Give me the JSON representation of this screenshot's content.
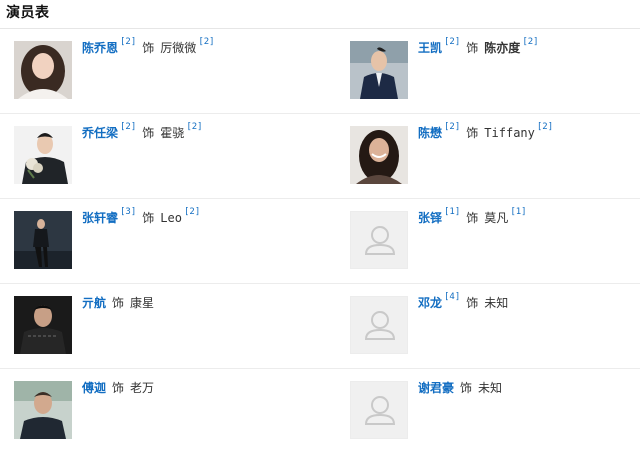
{
  "header": {
    "title": "演员表"
  },
  "rows": [
    {
      "left": {
        "actor": "陈乔恩",
        "actor_ref": "[2]",
        "as": "饰",
        "role": "厉微微",
        "role_ref": "[2]",
        "photo": "photo"
      },
      "right": {
        "actor": "王凯",
        "actor_ref": "[2]",
        "as": "饰",
        "role": "陈亦度",
        "role_ref": "[2]",
        "photo": "photo"
      }
    },
    {
      "left": {
        "actor": "乔任梁",
        "actor_ref": "[2]",
        "as": "饰",
        "role": "霍骁",
        "role_ref": "[2]",
        "photo": "photo"
      },
      "right": {
        "actor": "陈懋",
        "actor_ref": "[2]",
        "as": "饰",
        "role": "Tiffany",
        "role_ref": "[2]",
        "photo": "photo"
      }
    },
    {
      "left": {
        "actor": "张轩睿",
        "actor_ref": "[3]",
        "as": "饰",
        "role": "Leo",
        "role_ref": "[2]",
        "photo": "photo"
      },
      "right": {
        "actor": "张铎",
        "actor_ref": "[1]",
        "as": "饰",
        "role": "莫凡",
        "role_ref": "[1]",
        "photo": "placeholder"
      }
    },
    {
      "left": {
        "actor": "亓航",
        "actor_ref": "",
        "as": "饰",
        "role": "康星",
        "role_ref": "",
        "photo": "photo"
      },
      "right": {
        "actor": "邓龙",
        "actor_ref": "[4]",
        "as": "饰",
        "role": "未知",
        "role_ref": "",
        "photo": "placeholder"
      }
    },
    {
      "left": {
        "actor": "傅迦",
        "actor_ref": "",
        "as": "饰",
        "role": "老万",
        "role_ref": "",
        "photo": "photo"
      },
      "right": {
        "actor": "谢君豪",
        "actor_ref": "",
        "as": "饰",
        "role": "未知",
        "role_ref": "",
        "photo": "placeholder"
      }
    }
  ],
  "colors": {
    "link": "#136ec2",
    "divider": "#ececec",
    "placeholder_bg": "#f0f0f0"
  },
  "icons": {
    "placeholder": "user-silhouette-icon"
  }
}
